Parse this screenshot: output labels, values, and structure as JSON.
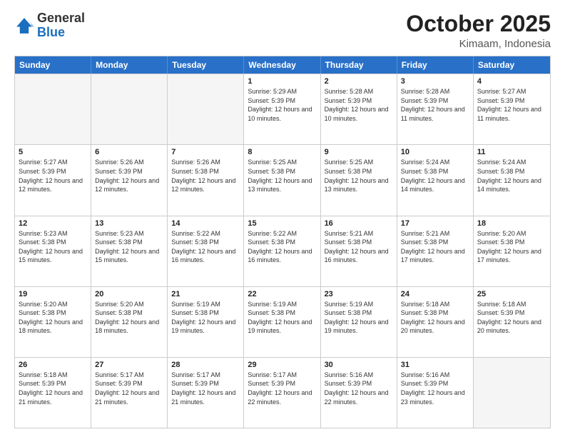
{
  "logo": {
    "line1": "General",
    "line2": "Blue"
  },
  "title": "October 2025",
  "subtitle": "Kimaam, Indonesia",
  "days_of_week": [
    "Sunday",
    "Monday",
    "Tuesday",
    "Wednesday",
    "Thursday",
    "Friday",
    "Saturday"
  ],
  "weeks": [
    [
      {
        "day": "",
        "info": "",
        "empty": true
      },
      {
        "day": "",
        "info": "",
        "empty": true
      },
      {
        "day": "",
        "info": "",
        "empty": true
      },
      {
        "day": "1",
        "info": "Sunrise: 5:29 AM\nSunset: 5:39 PM\nDaylight: 12 hours\nand 10 minutes."
      },
      {
        "day": "2",
        "info": "Sunrise: 5:28 AM\nSunset: 5:39 PM\nDaylight: 12 hours\nand 10 minutes."
      },
      {
        "day": "3",
        "info": "Sunrise: 5:28 AM\nSunset: 5:39 PM\nDaylight: 12 hours\nand 11 minutes."
      },
      {
        "day": "4",
        "info": "Sunrise: 5:27 AM\nSunset: 5:39 PM\nDaylight: 12 hours\nand 11 minutes."
      }
    ],
    [
      {
        "day": "5",
        "info": "Sunrise: 5:27 AM\nSunset: 5:39 PM\nDaylight: 12 hours\nand 12 minutes."
      },
      {
        "day": "6",
        "info": "Sunrise: 5:26 AM\nSunset: 5:39 PM\nDaylight: 12 hours\nand 12 minutes."
      },
      {
        "day": "7",
        "info": "Sunrise: 5:26 AM\nSunset: 5:38 PM\nDaylight: 12 hours\nand 12 minutes."
      },
      {
        "day": "8",
        "info": "Sunrise: 5:25 AM\nSunset: 5:38 PM\nDaylight: 12 hours\nand 13 minutes."
      },
      {
        "day": "9",
        "info": "Sunrise: 5:25 AM\nSunset: 5:38 PM\nDaylight: 12 hours\nand 13 minutes."
      },
      {
        "day": "10",
        "info": "Sunrise: 5:24 AM\nSunset: 5:38 PM\nDaylight: 12 hours\nand 14 minutes."
      },
      {
        "day": "11",
        "info": "Sunrise: 5:24 AM\nSunset: 5:38 PM\nDaylight: 12 hours\nand 14 minutes."
      }
    ],
    [
      {
        "day": "12",
        "info": "Sunrise: 5:23 AM\nSunset: 5:38 PM\nDaylight: 12 hours\nand 15 minutes."
      },
      {
        "day": "13",
        "info": "Sunrise: 5:23 AM\nSunset: 5:38 PM\nDaylight: 12 hours\nand 15 minutes."
      },
      {
        "day": "14",
        "info": "Sunrise: 5:22 AM\nSunset: 5:38 PM\nDaylight: 12 hours\nand 16 minutes."
      },
      {
        "day": "15",
        "info": "Sunrise: 5:22 AM\nSunset: 5:38 PM\nDaylight: 12 hours\nand 16 minutes."
      },
      {
        "day": "16",
        "info": "Sunrise: 5:21 AM\nSunset: 5:38 PM\nDaylight: 12 hours\nand 16 minutes."
      },
      {
        "day": "17",
        "info": "Sunrise: 5:21 AM\nSunset: 5:38 PM\nDaylight: 12 hours\nand 17 minutes."
      },
      {
        "day": "18",
        "info": "Sunrise: 5:20 AM\nSunset: 5:38 PM\nDaylight: 12 hours\nand 17 minutes."
      }
    ],
    [
      {
        "day": "19",
        "info": "Sunrise: 5:20 AM\nSunset: 5:38 PM\nDaylight: 12 hours\nand 18 minutes."
      },
      {
        "day": "20",
        "info": "Sunrise: 5:20 AM\nSunset: 5:38 PM\nDaylight: 12 hours\nand 18 minutes."
      },
      {
        "day": "21",
        "info": "Sunrise: 5:19 AM\nSunset: 5:38 PM\nDaylight: 12 hours\nand 19 minutes."
      },
      {
        "day": "22",
        "info": "Sunrise: 5:19 AM\nSunset: 5:38 PM\nDaylight: 12 hours\nand 19 minutes."
      },
      {
        "day": "23",
        "info": "Sunrise: 5:19 AM\nSunset: 5:38 PM\nDaylight: 12 hours\nand 19 minutes."
      },
      {
        "day": "24",
        "info": "Sunrise: 5:18 AM\nSunset: 5:38 PM\nDaylight: 12 hours\nand 20 minutes."
      },
      {
        "day": "25",
        "info": "Sunrise: 5:18 AM\nSunset: 5:39 PM\nDaylight: 12 hours\nand 20 minutes."
      }
    ],
    [
      {
        "day": "26",
        "info": "Sunrise: 5:18 AM\nSunset: 5:39 PM\nDaylight: 12 hours\nand 21 minutes."
      },
      {
        "day": "27",
        "info": "Sunrise: 5:17 AM\nSunset: 5:39 PM\nDaylight: 12 hours\nand 21 minutes."
      },
      {
        "day": "28",
        "info": "Sunrise: 5:17 AM\nSunset: 5:39 PM\nDaylight: 12 hours\nand 21 minutes."
      },
      {
        "day": "29",
        "info": "Sunrise: 5:17 AM\nSunset: 5:39 PM\nDaylight: 12 hours\nand 22 minutes."
      },
      {
        "day": "30",
        "info": "Sunrise: 5:16 AM\nSunset: 5:39 PM\nDaylight: 12 hours\nand 22 minutes."
      },
      {
        "day": "31",
        "info": "Sunrise: 5:16 AM\nSunset: 5:39 PM\nDaylight: 12 hours\nand 23 minutes."
      },
      {
        "day": "",
        "info": "",
        "empty": true
      }
    ]
  ]
}
